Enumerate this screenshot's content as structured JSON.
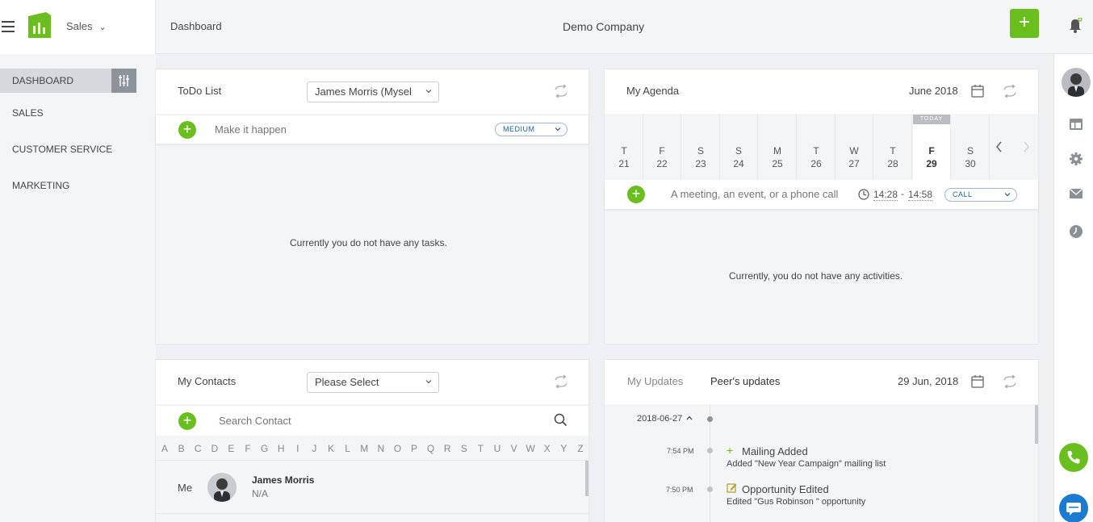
{
  "header": {
    "module": "Sales",
    "breadcrumb": "Dashboard",
    "company": "Demo Company",
    "add_label": "+"
  },
  "sidebar": {
    "items": [
      {
        "label": "DASHBOARD"
      },
      {
        "label": "SALES"
      },
      {
        "label": "CUSTOMER SERVICE"
      },
      {
        "label": "MARKETING"
      }
    ]
  },
  "todo": {
    "title": "ToDo List",
    "assignee": "James Morris (Mysel",
    "placeholder": "Make it happen",
    "priority": "MEDIUM",
    "empty": "Currently you do not have any tasks."
  },
  "agenda": {
    "title": "My Agenda",
    "month": "June 2018",
    "today_tag": "TODAY",
    "days": [
      {
        "name": "T",
        "date": "21"
      },
      {
        "name": "F",
        "date": "22"
      },
      {
        "name": "S",
        "date": "23"
      },
      {
        "name": "S",
        "date": "24"
      },
      {
        "name": "M",
        "date": "25"
      },
      {
        "name": "T",
        "date": "26"
      },
      {
        "name": "W",
        "date": "27"
      },
      {
        "name": "T",
        "date": "28"
      },
      {
        "name": "F",
        "date": "29"
      },
      {
        "name": "S",
        "date": "30"
      }
    ],
    "placeholder": "A meeting, an event, or a phone call",
    "time_from": "14:28",
    "time_sep": "-",
    "time_to": "14:58",
    "activity_type": "CALL",
    "empty": "Currently, you do not have any activities."
  },
  "contacts": {
    "title": "My Contacts",
    "filter": "Please Select",
    "search_placeholder": "Search Contact",
    "letters": [
      "A",
      "B",
      "C",
      "D",
      "E",
      "F",
      "G",
      "H",
      "I",
      "J",
      "K",
      "L",
      "M",
      "N",
      "O",
      "P",
      "Q",
      "R",
      "S",
      "T",
      "U",
      "V",
      "W",
      "X",
      "Y",
      "Z"
    ],
    "row": {
      "group": "Me",
      "name": "James Morris",
      "sub": "N/A"
    }
  },
  "updates": {
    "tab_mine": "My Updates",
    "tab_peers": "Peer's updates",
    "date": "29 Jun, 2018",
    "day_label": "2018-06-27",
    "entries": [
      {
        "time": "7:54 PM",
        "title": "Mailing Added",
        "desc": "Added \"New Year Campaign\" mailing list",
        "icon": "plus-icon"
      },
      {
        "time": "7:50 PM",
        "title": "Opportunity Edited",
        "desc": "Edited \"Gus Robinson \" opportunity",
        "icon": "edit-icon"
      }
    ]
  },
  "colors": {
    "accent_green": "#6abf1e",
    "chat_blue": "#1a7bd1"
  }
}
